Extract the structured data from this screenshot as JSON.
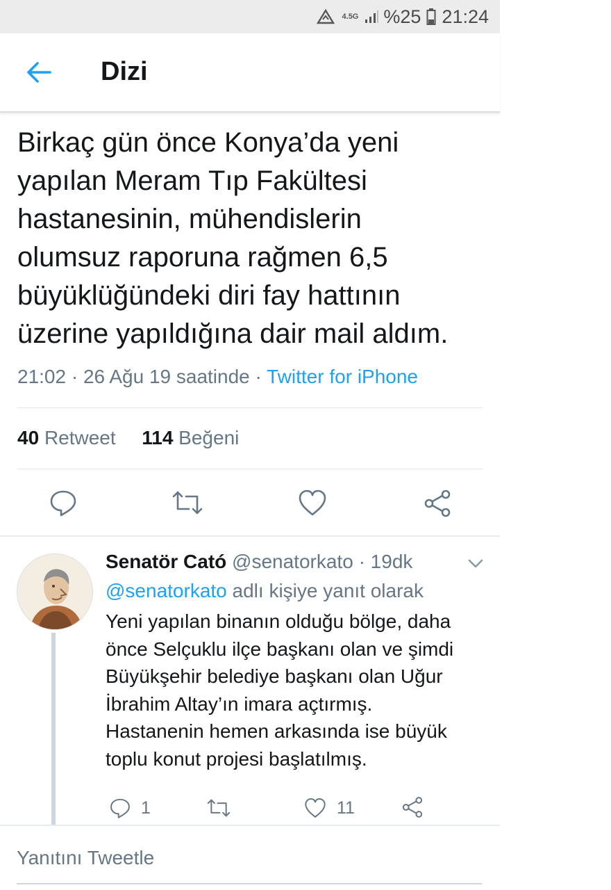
{
  "status_bar": {
    "network": "4.5G",
    "battery": "%25",
    "time": "21:24"
  },
  "header": {
    "title": "Dizi"
  },
  "tweet": {
    "text": "Birkaç gün önce Konya’da yeni\nyapılan Meram Tıp Fakültesi\nhastanesinin, mühendislerin\nolumsuz raporuna rağmen 6,5\nbüyüklüğündeki diri fay hattının\nüzerine yapıldığına dair mail aldım.",
    "time": "21:02",
    "date": "26 Ağu 19 saatinde",
    "separator": "·",
    "source": "Twitter for iPhone",
    "retweet_count": "40",
    "retweet_label": "Retweet",
    "like_count": "114",
    "like_label": "Beğeni"
  },
  "reply": {
    "name": "Senatör Cató",
    "handle": "@senatorkato",
    "age": "19dk",
    "replying_to_handle": "@senatorkato",
    "replying_to_label": "adlı kişiye yanıt olarak",
    "text": "Yeni yapılan binanın olduğu bölge, daha\nönce Selçuklu ilçe başkanı olan ve şimdi\nBüyükşehir belediye başkanı olan Uğur\nİbrahim Altay’ın imara açtırmış.\nHastanenin hemen arkasında ise büyük\ntoplu konut projesi başlatılmış.",
    "reply_count": "1",
    "like_count": "11"
  },
  "composer": {
    "placeholder": "Yanıtını Tweetle"
  },
  "colors": {
    "accent": "#1da1f2",
    "secondary_text": "#657786",
    "primary_text": "#14171a"
  },
  "icons": [
    "back-arrow-icon",
    "reply-icon",
    "retweet-icon",
    "like-icon",
    "share-icon",
    "chevron-down-icon",
    "signal-icon",
    "battery-icon",
    "data-saver-icon"
  ]
}
